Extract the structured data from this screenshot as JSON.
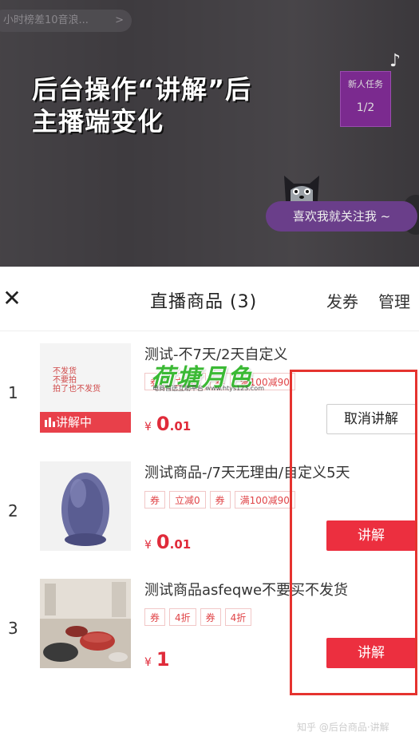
{
  "video": {
    "top_pill_text": "小时榜差10音浪...",
    "top_pill_chevron": ">",
    "headline_line1": "后台操作“讲解”后",
    "headline_line2": "主播端变化",
    "task_label": "新人任务",
    "task_progress": "1/2",
    "follow_text": "喜欢我就关注我 ~"
  },
  "panel": {
    "close_symbol": "✕",
    "title": "直播商品 (3)",
    "coupon_link": "发券",
    "manage_link": "管理",
    "live_badge": "讲解中",
    "thumb1_text_lines": [
      "不发货",
      "不要拍",
      "拍了也不发货"
    ],
    "products": [
      {
        "index": "1",
        "title": "测试-不7天/2天自定义",
        "coupons": [
          "券",
          "立减0",
          "券",
          "满100减90"
        ],
        "price_currency": "¥",
        "price_int": "0",
        "price_dec": ".01",
        "action": "取消讲解"
      },
      {
        "index": "2",
        "title": "测试商品-/7天无理由/自定义5天",
        "coupons": [
          "券",
          "立减0",
          "券",
          "满100减90"
        ],
        "price_currency": "¥",
        "price_int": "0",
        "price_dec": ".01",
        "action": "讲解"
      },
      {
        "index": "3",
        "title": "测试商品asfeqwe不要买不发货",
        "coupons": [
          "券",
          "4折",
          "券",
          "4折"
        ],
        "price_currency": "¥",
        "price_int": "1",
        "price_dec": "",
        "action": "讲解"
      }
    ]
  },
  "watermark": {
    "main": "荷塘月色",
    "sub": "电商首选互助平台 www.htys123.com",
    "corner": "知乎 @后台商品·讲解"
  },
  "colors": {
    "accent_red": "#ec2f3f",
    "annotation_red": "#e5332f",
    "watermark_green": "#3bb935",
    "follow_purple": "#6a3e8a"
  }
}
